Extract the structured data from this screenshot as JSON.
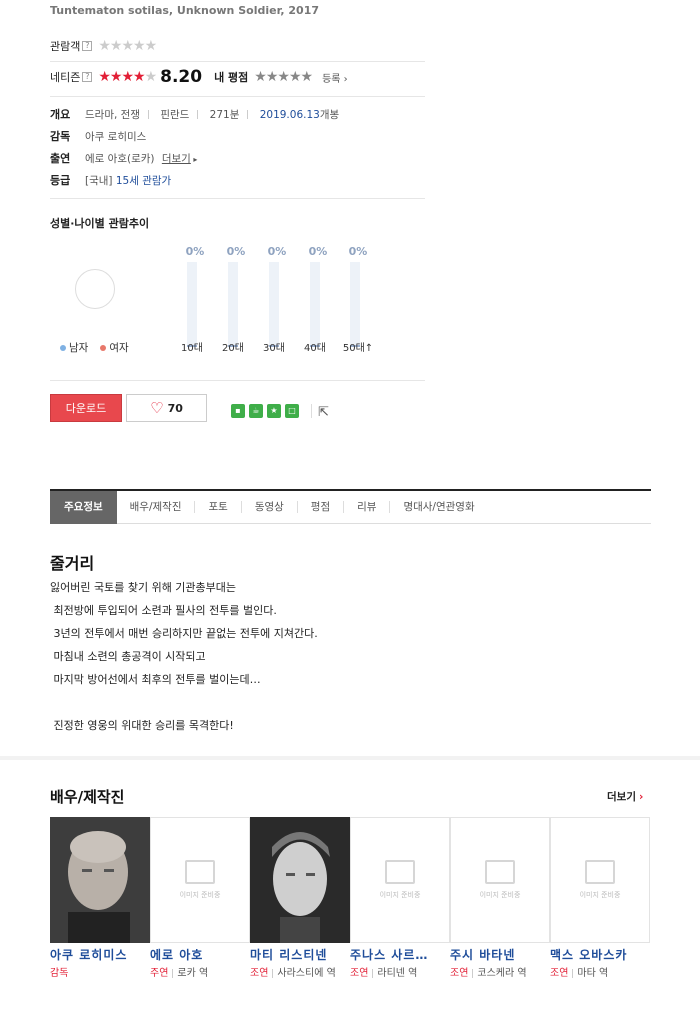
{
  "movie": {
    "english_title": "Tuntematon sotilas, Unknown Soldier, 2017"
  },
  "ratings": {
    "audience_label": "관람객",
    "netizen_label": "네티즌",
    "netizen_score": "8.20",
    "netizen_stars": 4,
    "my_label": "내 평점",
    "register": "등록",
    "help": "?"
  },
  "info": {
    "overview_label": "개요",
    "genre": "드라마, 전쟁",
    "country": "핀란드",
    "runtime": "271분",
    "release": "2019.06.13",
    "release_suffix": "개봉",
    "director_label": "감독",
    "director": "아쿠 로히미스",
    "cast_label": "출연",
    "cast": "에로 아호",
    "cast_role": "(로카)",
    "cast_more": "더보기",
    "grade_label": "등급",
    "grade_country": "[국내]",
    "grade": "15세 관람가"
  },
  "trend": {
    "title": "성별·나이별 관람추이",
    "legend_male": "남자",
    "legend_female": "여자",
    "male_color": "#7fb1e3",
    "female_color": "#e8786a",
    "ages": [
      {
        "label": "10대",
        "pct": "0%"
      },
      {
        "label": "20대",
        "pct": "0%"
      },
      {
        "label": "30대",
        "pct": "0%"
      },
      {
        "label": "40대",
        "pct": "0%"
      },
      {
        "label": "50대↑",
        "pct": "0%"
      }
    ]
  },
  "actions": {
    "download": "다운로드",
    "likes": "70"
  },
  "tabs": [
    "주요정보",
    "배우/제작진",
    "포토",
    "동영상",
    "평점",
    "리뷰",
    "명대사/연관영화"
  ],
  "synopsis": {
    "heading": "줄거리",
    "lines": [
      "잃어버린 국토를 찾기 위해 기관총부대는",
      " 최전방에 투입되어 소련과 필사의 전투를 벌인다.",
      " 3년의 전투에서 매번 승리하지만 끝없는 전투에 지쳐간다.",
      " 마침내 소련의 총공격이 시작되고",
      " 마지막 방어선에서 최후의 전투를 벌이는데…",
      "",
      " 진정한 영웅의 위대한 승리를 목격한다!"
    ]
  },
  "cast_section": {
    "heading": "배우/제작진",
    "more": "더보기",
    "placeholder_text": "이미지 준비중",
    "people": [
      {
        "name": "아쿠 로히미스",
        "role": "감독",
        "character": "",
        "photo": true
      },
      {
        "name": "에로 아호",
        "role": "주연",
        "character": "로카 역",
        "photo": false
      },
      {
        "name": "마티 리스티넨",
        "role": "조연",
        "character": "사라스티에 역",
        "photo": true
      },
      {
        "name": "주나스 사르…",
        "role": "조연",
        "character": "라티넨 역",
        "photo": false
      },
      {
        "name": "주시 바타넨",
        "role": "조연",
        "character": "코스케라 역",
        "photo": false
      },
      {
        "name": "맥스 오바스카",
        "role": "조연",
        "character": "마타 역",
        "photo": false
      }
    ]
  }
}
